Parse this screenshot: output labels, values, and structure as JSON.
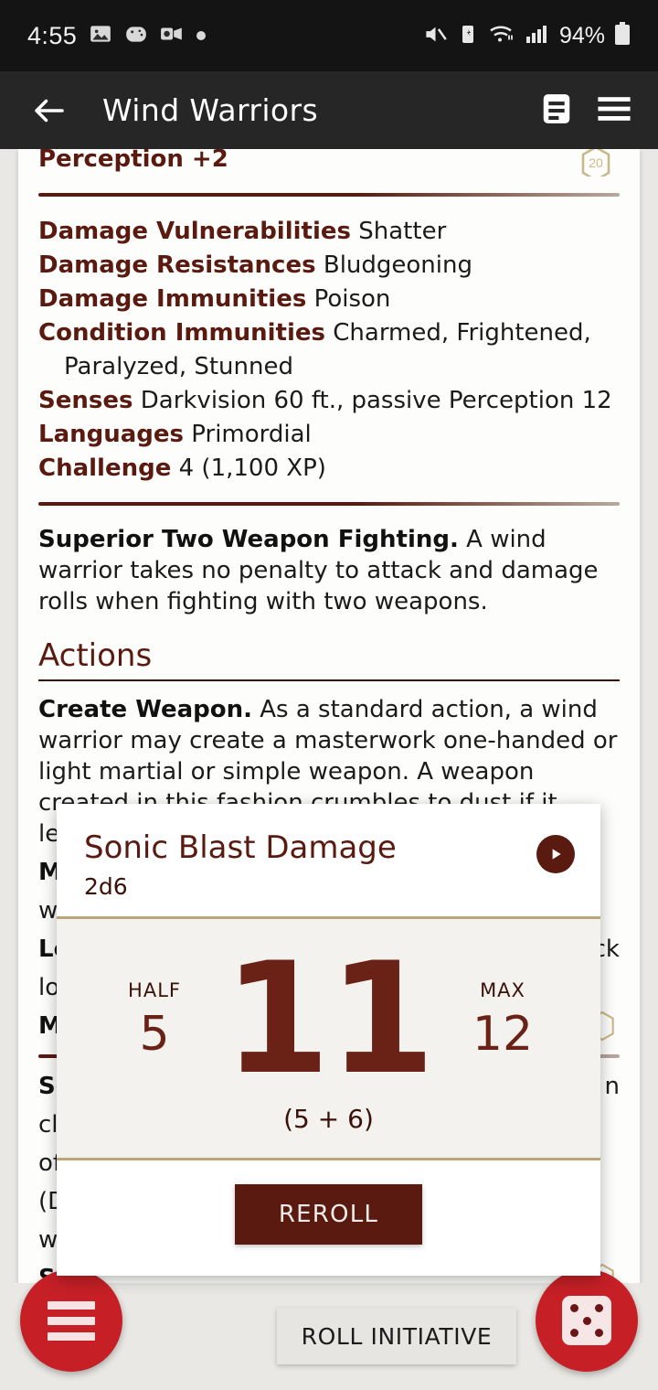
{
  "statusbar": {
    "time": "4:55",
    "battery_percent": "94%",
    "icons": [
      "photos-icon",
      "game-controller-icon",
      "outlook-video-icon",
      "dot-icon",
      "mute-icon",
      "battery-saver-icon",
      "wifi-icon",
      "cellular-signal-icon",
      "battery-icon"
    ]
  },
  "appbar": {
    "back_label": "back-arrow",
    "title": "Wind Warriors",
    "notes_label": "notes-icon",
    "menu_label": "menu-icon"
  },
  "statblock": {
    "clipped_top_line": "Perception +2",
    "traits": [
      {
        "label": "Damage Vulnerabilities",
        "value": "Shatter"
      },
      {
        "label": "Damage Resistances",
        "value": "Bludgeoning"
      },
      {
        "label": "Damage Immunities",
        "value": "Poison"
      },
      {
        "label": "Condition Immunities",
        "value": "Charmed, Frightened,"
      },
      {
        "label": "",
        "value": "Paralyzed, Stunned",
        "indent": true
      },
      {
        "label": "Senses",
        "value": "Darkvision 60 ft., passive Perception 12"
      },
      {
        "label": "Languages",
        "value": "Primordial"
      },
      {
        "label": "Challenge",
        "value": "4 (1,100 XP)"
      }
    ],
    "feature": {
      "name": "Superior Two Weapon Fighting.",
      "text": " A wind warrior takes no penalty to attack and damage rolls when fighting with two weapons."
    },
    "actions_heading": "Actions",
    "actions": [
      {
        "name": "Create Weapon.",
        "text": " As a standard action, a wind warrior may create a masterwork one-handed or light martial or simple weapon. A weapon created in this fashion crumbles to dust if it leaves the wind w"
      }
    ],
    "obscured_left_fragments": [
      "M",
      "w",
      "Lo",
      "lo",
      "M",
      "So",
      "cl",
      "of",
      "(D",
      "w",
      "So"
    ],
    "obscured_right_fragments": [
      "ck",
      "n"
    ],
    "d20_badge": "20"
  },
  "dialog": {
    "title": "Sonic Blast Damage",
    "formula": "2d6",
    "play_label": "play-icon",
    "half_caption": "HALF",
    "half_value": "5",
    "total": "11",
    "max_caption": "MAX",
    "max_value": "12",
    "breakdown": "(5 + 6)",
    "reroll_label": "REROLL"
  },
  "bottombar": {
    "initiative_label": "ROLL INITIATIVE",
    "left_fab": "list-menu-icon",
    "right_fab": "dice-icon"
  },
  "colors": {
    "accent_maroon": "#5a1a10",
    "roll_maroon": "#6b2216",
    "fab_red": "#c62026",
    "gold_rule": "#b9a77a",
    "dialog_body": "#f4f2ee",
    "page_bg": "#e9e8e4",
    "appbar_bg": "#262626",
    "statusbar_bg": "#141414"
  }
}
